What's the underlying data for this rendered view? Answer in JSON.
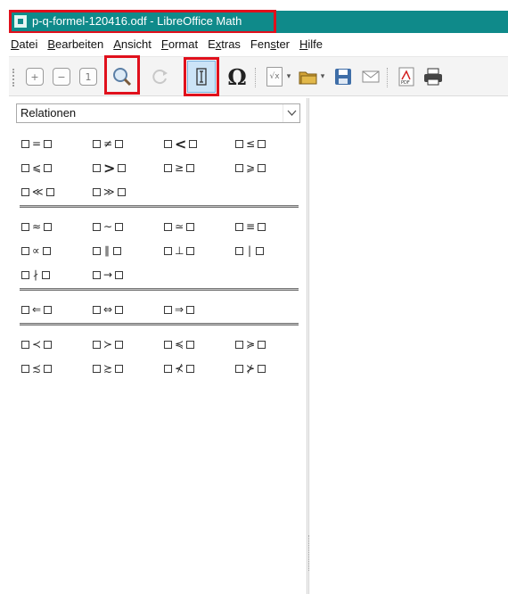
{
  "window": {
    "title": "p-q-formel-120416.odf - LibreOffice Math"
  },
  "menu": {
    "items": [
      {
        "underline": "D",
        "rest": "atei"
      },
      {
        "underline": "B",
        "rest": "earbeiten"
      },
      {
        "underline": "A",
        "rest": "nsicht"
      },
      {
        "underline": "F",
        "rest": "ormat"
      },
      {
        "pre": "E",
        "underline": "x",
        "rest": "tras"
      },
      {
        "pre": "Fen",
        "underline": "s",
        "rest": "ter"
      },
      {
        "underline": "H",
        "rest": "ilfe"
      }
    ]
  },
  "toolbar": {
    "buttons": [
      {
        "name": "zoom-in",
        "glyph": "⊕"
      },
      {
        "name": "zoom-out",
        "glyph": "⊖"
      },
      {
        "name": "show-all",
        "glyph": "1"
      },
      {
        "name": "zoom-formula",
        "glyph": "🔍"
      },
      {
        "name": "update",
        "glyph": "↻"
      },
      {
        "name": "formula-cursor",
        "glyph": "I"
      },
      {
        "name": "symbols",
        "glyph": "Ω"
      },
      {
        "name": "import-formula",
        "glyph": "√x"
      },
      {
        "name": "open",
        "glyph": "📂"
      },
      {
        "name": "save",
        "glyph": "💾"
      },
      {
        "name": "email",
        "glyph": "✉"
      },
      {
        "name": "export-pdf",
        "glyph": "PDF"
      },
      {
        "name": "print",
        "glyph": "🖨"
      }
    ]
  },
  "elements_panel": {
    "category": "Relationen",
    "groups": [
      [
        [
          "=",
          "≠",
          "<",
          "≤"
        ],
        [
          "⩽",
          ">",
          "≥",
          "⩾"
        ],
        [
          "≪",
          "≫"
        ]
      ],
      [
        [
          "≈",
          "∼",
          "≃",
          "≡"
        ],
        [
          "∝",
          "∥",
          "⊥",
          "|"
        ],
        [
          "∤",
          "→"
        ]
      ],
      [
        [
          "⇐",
          "⇔",
          "⇒"
        ]
      ],
      [
        [
          "≺",
          "≻",
          "≼",
          "≽"
        ],
        [
          "≾",
          "≿",
          "⊀",
          "⊁"
        ]
      ]
    ]
  }
}
